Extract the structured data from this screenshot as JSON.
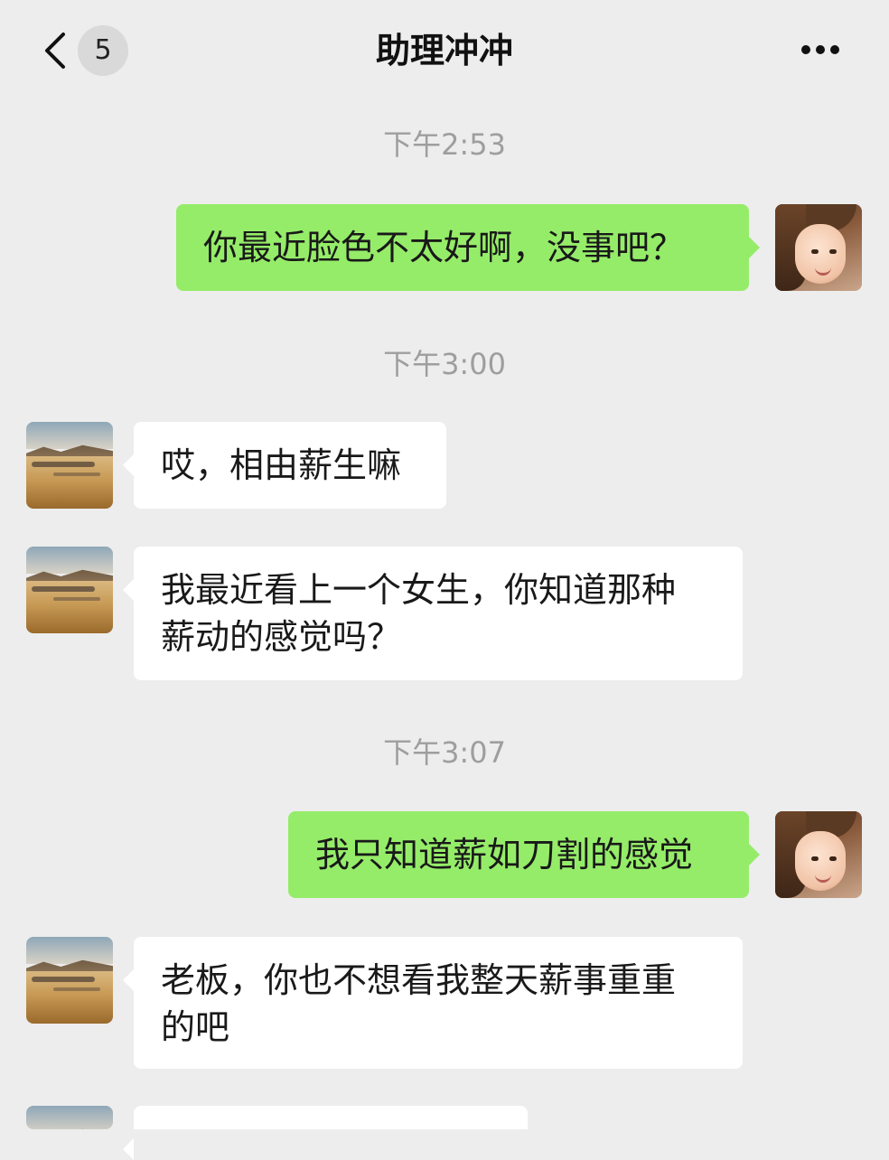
{
  "header": {
    "back_icon": "chevron-left-icon",
    "unread_count": "5",
    "title": "助理冲冲",
    "more_icon": "more-dots-icon"
  },
  "timestamps": [
    "下午2:53",
    "下午3:00",
    "下午3:07"
  ],
  "messages": [
    {
      "from": "me",
      "text": "你最近脸色不太好啊，没事吧？"
    },
    {
      "from": "them",
      "text": "哎，相由薪生嘛"
    },
    {
      "from": "them",
      "line1": "我最近看上一个女生，你知道那种",
      "line2": "薪动的感觉吗？"
    },
    {
      "from": "me",
      "text": "我只知道薪如刀割的感觉"
    },
    {
      "from": "them",
      "line1": "老板，你也不想看我整天薪事重重",
      "line2": "的吧"
    }
  ],
  "colors": {
    "background": "#ededed",
    "my_bubble": "#95ec69",
    "their_bubble": "#ffffff",
    "timestamp": "#9e9e9e"
  }
}
